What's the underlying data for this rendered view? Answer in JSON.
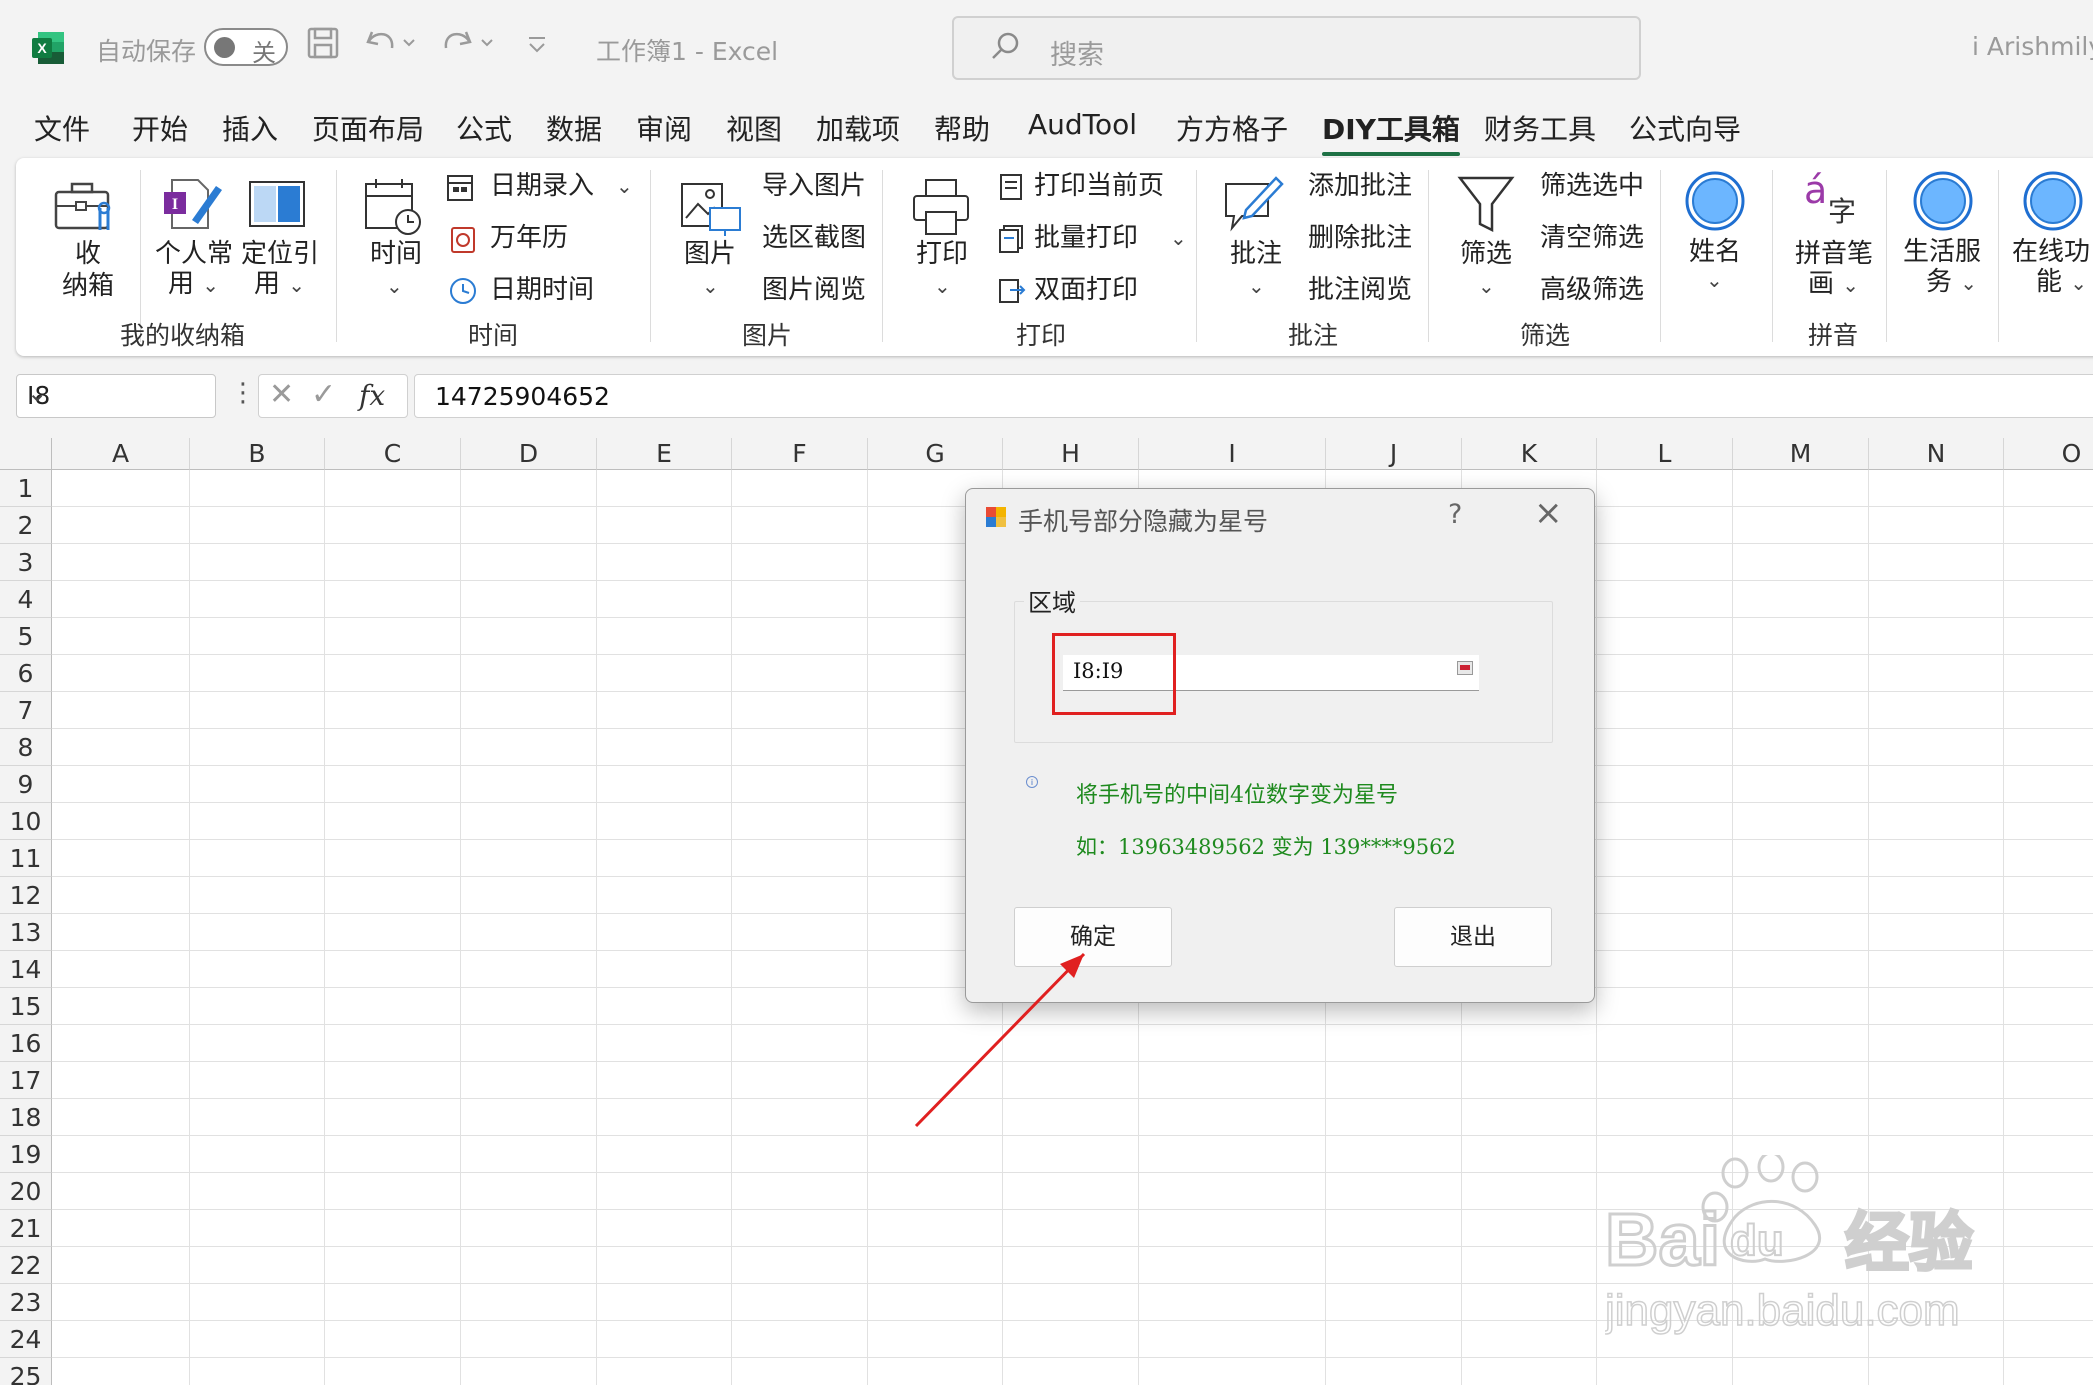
{
  "titlebar": {
    "autosave_label": "自动保存",
    "autosave_state": "关",
    "workbook_title": "工作簿1  -  Excel",
    "search_placeholder": "搜索",
    "user_name": "i Arishmily"
  },
  "tabs": [
    "文件",
    "开始",
    "插入",
    "页面布局",
    "公式",
    "数据",
    "审阅",
    "视图",
    "加载项",
    "帮助",
    "AudTool",
    "方方格子",
    "DIY工具箱",
    "财务工具",
    "公式向导"
  ],
  "active_tab": "DIY工具箱",
  "ribbon": {
    "storage": {
      "btn_shou": "收",
      "btn_nabox": "纳箱",
      "personal_1": "个人常",
      "personal_2": "用",
      "locate_1": "定位引",
      "locate_2": "用",
      "group": "我的收纳箱"
    },
    "time": {
      "time_btn": "时间",
      "date_entry": "日期录入",
      "calendar": "万年历",
      "datetime": "日期时间",
      "group": "时间"
    },
    "picture": {
      "picture_btn": "图片",
      "import_pic": "导入图片",
      "select_capture": "选区截图",
      "pic_browse": "图片阅览",
      "group": "图片"
    },
    "print": {
      "print_btn": "打印",
      "print_current": "打印当前页",
      "batch_print": "批量打印",
      "duplex_print": "双面打印",
      "group": "打印"
    },
    "comment": {
      "comment_btn": "批注",
      "add_comment": "添加批注",
      "delete_comment": "删除批注",
      "browse_comment": "批注阅览",
      "group": "批注"
    },
    "filter": {
      "filter_btn": "筛选",
      "filter_selected": "筛选选中",
      "clear_filter": "清空筛选",
      "advanced_filter": "高级筛选",
      "group": "筛选"
    },
    "name": {
      "name_btn": "姓名"
    },
    "pinyin": {
      "pinyin_icon_a": "á",
      "pinyin_icon_zi": "字",
      "pinyin_1": "拼音笔",
      "pinyin_2": "画",
      "group": "拼音"
    },
    "life": {
      "life_1": "生活服",
      "life_2": "务"
    },
    "online": {
      "online_1": "在线功",
      "online_2": "能"
    }
  },
  "formula_bar": {
    "name_box": "I8",
    "fx": "fx",
    "value": "14725904652"
  },
  "grid": {
    "columns": [
      "A",
      "B",
      "C",
      "D",
      "E",
      "F",
      "G",
      "H",
      "I",
      "J",
      "K",
      "L",
      "M",
      "N",
      "O"
    ],
    "rows": [
      "1",
      "2",
      "3",
      "4",
      "5",
      "6",
      "7",
      "8",
      "9",
      "10",
      "11",
      "12",
      "13",
      "14",
      "15",
      "16",
      "17",
      "18",
      "19",
      "20",
      "21",
      "22",
      "23",
      "24",
      "25"
    ]
  },
  "dialog": {
    "title": "手机号部分隐藏为星号",
    "help": "?",
    "range_label": "区域",
    "range_value": "I8:I9",
    "info_icon": "i",
    "message": "将手机号的中间4位数字变为星号",
    "example": "如：13963489562 变为 139****9562",
    "ok_label": "确定",
    "exit_label": "退出"
  },
  "watermark": {
    "brand": "Bai",
    "paw_text": "du",
    "cn": "经验",
    "url": "jingyan.baidu.com"
  },
  "colors": {
    "excel_green": "#1e7145",
    "dialog_message": "#1e8a1e",
    "highlight_red": "#e02020"
  }
}
